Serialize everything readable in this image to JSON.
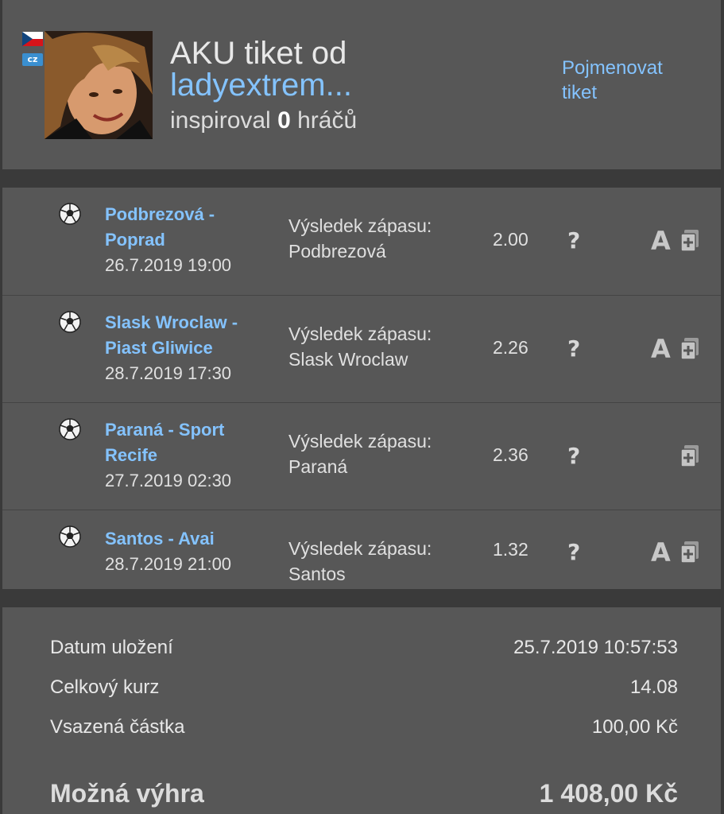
{
  "header": {
    "country_badge": "cz",
    "title_line1": "AKU tiket od",
    "username": "ladyextrem...",
    "inspired_prefix": "inspiroval",
    "inspired_count": "0",
    "inspired_suffix": "hráčů",
    "rename_link": "Pojmenovat tiket"
  },
  "bets": [
    {
      "teams": "Podbrezová - Poprad",
      "datetime": "26.7.2019 19:00",
      "market_label": "Výsledek zápasu:",
      "selection": "Podbrezová",
      "odds": "2.00",
      "status": "?",
      "has_a_icon": true
    },
    {
      "teams": "Slask Wroclaw - Piast Gliwice",
      "datetime": "28.7.2019 17:30",
      "market_label": "Výsledek zápasu:",
      "selection": "Slask Wroclaw",
      "odds": "2.26",
      "status": "?",
      "has_a_icon": true
    },
    {
      "teams": "Paraná - Sport Recife",
      "datetime": "27.7.2019 02:30",
      "market_label": "Výsledek zápasu:",
      "selection": "Paraná",
      "odds": "2.36",
      "status": "?",
      "has_a_icon": false
    },
    {
      "teams": "Santos - Avai",
      "datetime": "28.7.2019 21:00",
      "market_label": "Výsledek zápasu:",
      "selection": "Santos",
      "odds": "1.32",
      "status": "?",
      "has_a_icon": true
    }
  ],
  "a_icon_letter": "A",
  "summary": {
    "saved_label": "Datum uložení",
    "saved_value": "25.7.2019 10:57:53",
    "total_odds_label": "Celkový kurz",
    "total_odds_value": "14.08",
    "stake_label": "Vsazená částka",
    "stake_value": "100,00 Kč",
    "win_label": "Možná výhra",
    "win_value": "1 408,00 Kč"
  },
  "colors": {
    "link": "#84c3ff",
    "panel": "#575757",
    "background": "#3a3a3a"
  }
}
